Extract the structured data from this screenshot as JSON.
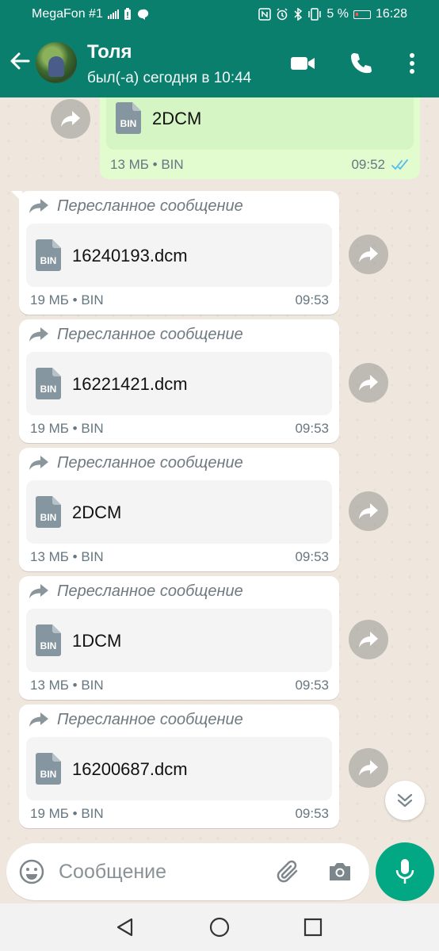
{
  "status_bar": {
    "carrier": "MegaFon #1",
    "battery": "5 %",
    "time": "16:28"
  },
  "chat_header": {
    "contact_name": "Толя",
    "last_seen": "был(-а) сегодня в 10:44"
  },
  "outgoing_message": {
    "file_name": "2DCM",
    "icon_label": "BIN",
    "meta": "13 МБ • BIN",
    "time": "09:52"
  },
  "messages": [
    {
      "forwarded_label": "Пересланное сообщение",
      "icon_label": "BIN",
      "file_name": "16240193.dcm",
      "meta": "19 МБ • BIN",
      "time": "09:53"
    },
    {
      "forwarded_label": "Пересланное сообщение",
      "icon_label": "BIN",
      "file_name": "16221421.dcm",
      "meta": "19 МБ • BIN",
      "time": "09:53"
    },
    {
      "forwarded_label": "Пересланное сообщение",
      "icon_label": "BIN",
      "file_name": "2DCM",
      "meta": "13 МБ • BIN",
      "time": "09:53"
    },
    {
      "forwarded_label": "Пересланное сообщение",
      "icon_label": "BIN",
      "file_name": "1DCM",
      "meta": "13 МБ • BIN",
      "time": "09:53"
    },
    {
      "forwarded_label": "Пересланное сообщение",
      "icon_label": "BIN",
      "file_name": "16200687.dcm",
      "meta": "19 МБ • BIN",
      "time": "09:53"
    }
  ],
  "composer": {
    "placeholder": "Сообщение"
  },
  "colors": {
    "header": "#0b7f6e",
    "mic_button": "#02a884",
    "outgoing_bubble": "#e2fcd0",
    "read_ticks": "#53bdeb"
  }
}
